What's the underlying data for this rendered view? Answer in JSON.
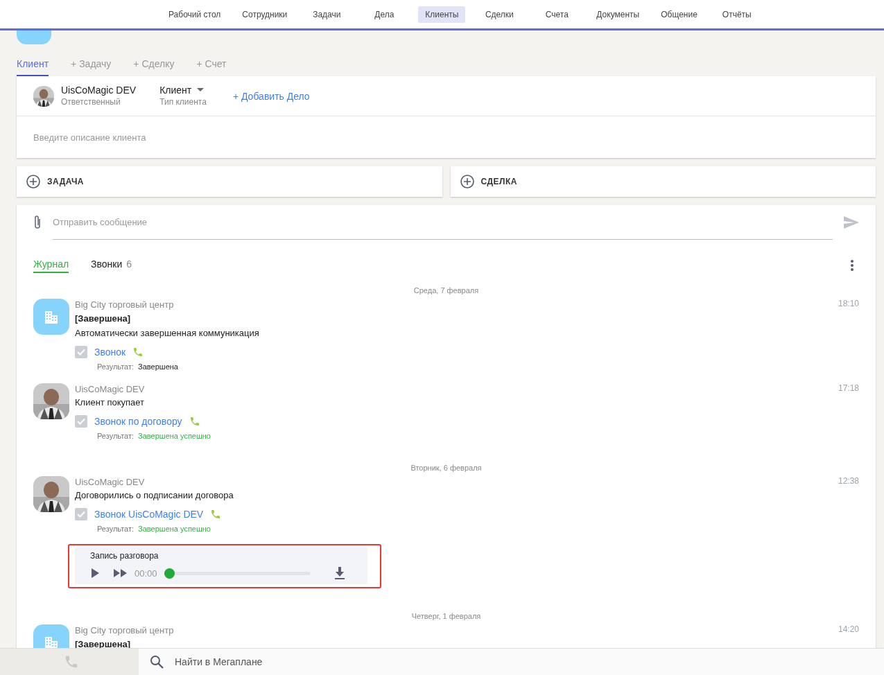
{
  "nav": [
    {
      "label": "Рабочий стол",
      "selected": false
    },
    {
      "label": "Сотрудники",
      "selected": false
    },
    {
      "label": "Задачи",
      "selected": false
    },
    {
      "label": "Дела",
      "selected": false
    },
    {
      "label": "Клиенты",
      "selected": true
    },
    {
      "label": "Сделки",
      "selected": false
    },
    {
      "label": "Счета",
      "selected": false
    },
    {
      "label": "Документы",
      "selected": false
    },
    {
      "label": "Общение",
      "selected": false
    },
    {
      "label": "Отчёты",
      "selected": false
    }
  ],
  "sub_tabs": [
    {
      "label": "Клиент",
      "selected": true
    },
    {
      "label": "+ Задачу",
      "selected": false
    },
    {
      "label": "+ Сделку",
      "selected": false
    },
    {
      "label": "+ Счет",
      "selected": false
    }
  ],
  "client_card": {
    "responsible_name": "UisCoMagic DEV",
    "responsible_label": "Ответственный",
    "client_type": "Клиент",
    "client_type_label": "Тип клиента",
    "add_action": "+ Добавить Дело",
    "description_placeholder": "Введите описание клиента"
  },
  "quick_add": [
    {
      "label": "ЗАДАЧА"
    },
    {
      "label": "СДЕЛКА"
    }
  ],
  "composer": {
    "placeholder": "Отправить сообщение"
  },
  "feed_tabs": [
    {
      "label": "Журнал",
      "selected": true
    },
    {
      "label": "Звонки",
      "count": "6",
      "selected": false
    }
  ],
  "feed": [
    {
      "kind": "date",
      "label": "Среда, 7 февраля"
    },
    {
      "kind": "company_entry",
      "author": "Big City торговый центр",
      "time": "18:10",
      "status": "[Завершена]",
      "text": "Автоматически завершенная коммуникация",
      "call": {
        "title": "Звонок",
        "checked": true,
        "result_label": "Результат:",
        "result": "Завершена",
        "success": false
      }
    },
    {
      "kind": "person_entry",
      "author": "UisCoMagic DEV",
      "time": "17:18",
      "text": "Клиент покупает",
      "call": {
        "title": "Звонок по договору",
        "checked": true,
        "result_label": "Результат:",
        "result": "Завершена успешно",
        "success": true
      }
    },
    {
      "kind": "date",
      "label": "Вторник, 6 февраля"
    },
    {
      "kind": "person_entry",
      "author": "UisCoMagic DEV",
      "time": "12:38",
      "text": "Договорились о подписании договора",
      "call": {
        "title": "Звонок UisCoMagic DEV",
        "checked": true,
        "result_label": "Результат:",
        "result": "Завершена успешно",
        "success": true
      },
      "recording": {
        "title": "Запись разговора",
        "time": "00:00",
        "level": 0,
        "highlighted": true
      }
    },
    {
      "kind": "date",
      "label": "Четверг, 1 февраля"
    },
    {
      "kind": "company_entry",
      "author": "Big City торговый центр",
      "time": "14:20",
      "status": "[Завершена]"
    }
  ],
  "search": {
    "placeholder": "Найти в Мегаплане"
  }
}
